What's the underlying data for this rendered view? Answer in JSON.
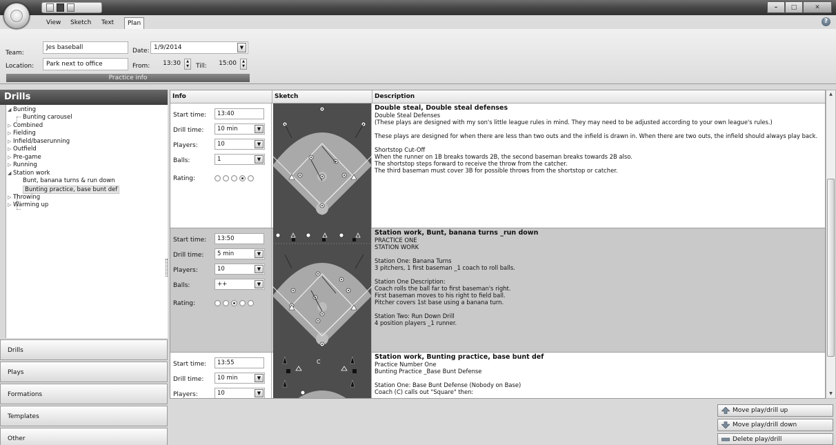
{
  "ribbon": {
    "tabs": [
      "View",
      "Sketch",
      "Text",
      "Plan"
    ],
    "active_tab": "Plan",
    "team_label": "Team:",
    "team_value": "Jes baseball",
    "date_label": "Date:",
    "date_value": "1/9/2014",
    "location_label": "Location:",
    "location_value": "Park next to office",
    "from_label": "From:",
    "from_value": "13:30",
    "till_label": "Till:",
    "till_value": "15:00",
    "group_label": "Practice info"
  },
  "sidebar": {
    "header": "Drills",
    "tree": [
      {
        "label": "Bunting",
        "expanded": true
      },
      {
        "label": "Bunting carousel",
        "child": true
      },
      {
        "label": "Combined"
      },
      {
        "label": "Fielding"
      },
      {
        "label": "Infield/baserunning"
      },
      {
        "label": "Outfield"
      },
      {
        "label": "Pre-game"
      },
      {
        "label": "Running"
      },
      {
        "label": "Station work",
        "expanded": true
      },
      {
        "label": "Bunt, banana turns & run down",
        "child": true
      },
      {
        "label": "Bunting practice, base bunt def",
        "child": true,
        "selected": true
      },
      {
        "label": "Throwing"
      },
      {
        "label": "Warming up"
      }
    ],
    "nav": [
      "Drills",
      "Plays",
      "Formations",
      "Templates",
      "Other"
    ]
  },
  "grid": {
    "headers": [
      "Info",
      "Sketch",
      "Description"
    ],
    "info_labels": {
      "start": "Start time:",
      "drill": "Drill time:",
      "players": "Players:",
      "balls": "Balls:",
      "rating": "Rating:"
    },
    "rows": [
      {
        "start": "13:40",
        "drill": "10 min",
        "players": "10",
        "balls": "1",
        "rating": 4,
        "title": "Double steal, Double steal defenses",
        "lines": [
          "Double Steal Defenses",
          "(These plays are designed with my son's little league rules in mind.  They may need to be adjusted according to your own league's rules.)",
          "",
          "These plays are designed for when there are less than two outs and the infield is drawn in.  When there are two outs, the infield should always play back.",
          "",
          "Shortstop Cut-Off",
          "When the runner on 1B breaks towards 2B, the second baseman breaks towards 2B also.",
          "The shortstop steps forward to receive the throw from the catcher.",
          "The third baseman must cover 3B for possible throws from the shortstop or catcher."
        ]
      },
      {
        "start": "13:50",
        "drill": "5 min",
        "players": "10",
        "balls": "++",
        "rating": 3,
        "title": "Station work, Bunt, banana turns _run down",
        "lines": [
          "PRACTICE ONE",
          "STATION WORK",
          "",
          "Station One:  Banana Turns",
          "3 pitchers, 1 first baseman _1 coach to roll balls.",
          "",
          "Station One Description:",
          "Coach rolls the ball far to first baseman's right.",
          "First baseman moves to his right to field ball.",
          "Pitcher covers 1st base using a banana turn.",
          "",
          "Station Two:  Run Down Drill",
          "4 position players _1 runner."
        ]
      },
      {
        "start": "13:55",
        "drill": "10 min",
        "players": "10",
        "balls": "",
        "rating": 0,
        "title": "Station work, Bunting practice, base bunt def",
        "lines": [
          "Practice Number One",
          "Bunting Practice _Base Bunt Defense",
          "",
          "Station One:  Base Bunt Defense (Nobody on Base)",
          "Coach (C) calls out \"Square\" then:"
        ]
      }
    ]
  },
  "actions": {
    "up": "Move play/drill up",
    "down": "Move play/drill down",
    "delete": "Delete play/drill"
  },
  "colors": {
    "field_green": "#a9a9a9",
    "infield": "#cfcfcf",
    "dark": "#4d4d4d"
  }
}
